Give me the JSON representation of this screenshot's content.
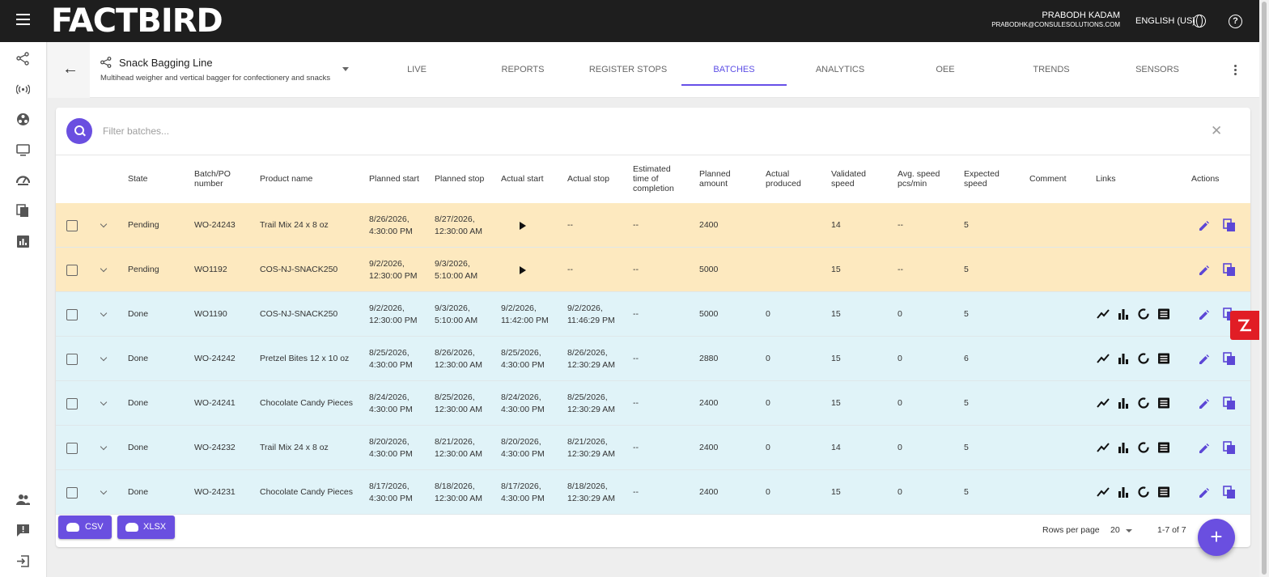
{
  "app": {
    "logo": "FACTBIRD"
  },
  "user": {
    "name": "PRABODH KADAM",
    "email": "PRABODHK@CONSULESOLUTIONS.COM"
  },
  "language": "ENGLISH (US)",
  "line": {
    "name": "Snack Bagging Line",
    "description": "Multihead weigher and vertical bagger for confectionery and snacks"
  },
  "tabs": [
    {
      "label": "LIVE"
    },
    {
      "label": "REPORTS"
    },
    {
      "label": "REGISTER STOPS"
    },
    {
      "label": "BATCHES",
      "active": true
    },
    {
      "label": "ANALYTICS"
    },
    {
      "label": "OEE"
    },
    {
      "label": "TRENDS"
    },
    {
      "label": "SENSORS"
    }
  ],
  "search": {
    "placeholder": "Filter batches..."
  },
  "columns": {
    "state": "State",
    "batch": "Batch/PO number",
    "product": "Product name",
    "planned_start": "Planned start",
    "planned_stop": "Planned stop",
    "actual_start": "Actual start",
    "actual_stop": "Actual stop",
    "est": "Estimated time of completion",
    "planned_amount": "Planned amount",
    "actual_produced": "Actual produced",
    "validated_speed": "Validated speed",
    "avg_speed": "Avg. speed pcs/min",
    "expected_speed": "Expected speed",
    "comment": "Comment",
    "links": "Links",
    "actions": "Actions"
  },
  "rows": [
    {
      "state": "Pending",
      "batch": "WO-24243",
      "product": "Trail Mix 24 x 8 oz",
      "planned_start": [
        "8/26/2026,",
        "4:30:00 PM"
      ],
      "planned_stop": [
        "8/27/2026,",
        "12:30:00 AM"
      ],
      "actual_start": "",
      "actual_stop": "--",
      "est": "--",
      "planned_amount": "2400",
      "actual_produced": "",
      "validated_speed": "14",
      "avg_speed": "--",
      "expected_speed": "5",
      "comment": ""
    },
    {
      "state": "Pending",
      "batch": "WO1192",
      "product": "COS-NJ-SNACK250",
      "planned_start": [
        "9/2/2026,",
        "12:30:00 PM"
      ],
      "planned_stop": [
        "9/3/2026,",
        "5:10:00 AM"
      ],
      "actual_start": "",
      "actual_stop": "--",
      "est": "--",
      "planned_amount": "5000",
      "actual_produced": "",
      "validated_speed": "15",
      "avg_speed": "--",
      "expected_speed": "5",
      "comment": ""
    },
    {
      "state": "Done",
      "batch": "WO1190",
      "product": "COS-NJ-SNACK250",
      "planned_start": [
        "9/2/2026,",
        "12:30:00 PM"
      ],
      "planned_stop": [
        "9/3/2026,",
        "5:10:00 AM"
      ],
      "actual_start": [
        "9/2/2026,",
        "11:42:00 PM"
      ],
      "actual_stop": [
        "9/2/2026,",
        "11:46:29 PM"
      ],
      "est": "--",
      "planned_amount": "5000",
      "actual_produced": "0",
      "validated_speed": "15",
      "avg_speed": "0",
      "expected_speed": "5",
      "comment": ""
    },
    {
      "state": "Done",
      "batch": "WO-24242",
      "product": "Pretzel Bites 12 x 10 oz",
      "planned_start": [
        "8/25/2026,",
        "4:30:00 PM"
      ],
      "planned_stop": [
        "8/26/2026,",
        "12:30:00 AM"
      ],
      "actual_start": [
        "8/25/2026,",
        "4:30:00 PM"
      ],
      "actual_stop": [
        "8/26/2026,",
        "12:30:29 AM"
      ],
      "est": "--",
      "planned_amount": "2880",
      "actual_produced": "0",
      "validated_speed": "15",
      "avg_speed": "0",
      "expected_speed": "6",
      "comment": ""
    },
    {
      "state": "Done",
      "batch": "WO-24241",
      "product": "Chocolate Candy Pieces",
      "planned_start": [
        "8/24/2026,",
        "4:30:00 PM"
      ],
      "planned_stop": [
        "8/25/2026,",
        "12:30:00 AM"
      ],
      "actual_start": [
        "8/24/2026,",
        "4:30:00 PM"
      ],
      "actual_stop": [
        "8/25/2026,",
        "12:30:29 AM"
      ],
      "est": "--",
      "planned_amount": "2400",
      "actual_produced": "0",
      "validated_speed": "15",
      "avg_speed": "0",
      "expected_speed": "5",
      "comment": ""
    },
    {
      "state": "Done",
      "batch": "WO-24232",
      "product": "Trail Mix 24 x 8 oz",
      "planned_start": [
        "8/20/2026,",
        "4:30:00 PM"
      ],
      "planned_stop": [
        "8/21/2026,",
        "12:30:00 AM"
      ],
      "actual_start": [
        "8/20/2026,",
        "4:30:00 PM"
      ],
      "actual_stop": [
        "8/21/2026,",
        "12:30:29 AM"
      ],
      "est": "--",
      "planned_amount": "2400",
      "actual_produced": "0",
      "validated_speed": "14",
      "avg_speed": "0",
      "expected_speed": "5",
      "comment": ""
    },
    {
      "state": "Done",
      "batch": "WO-24231",
      "product": "Chocolate Candy Pieces",
      "planned_start": [
        "8/17/2026,",
        "4:30:00 PM"
      ],
      "planned_stop": [
        "8/18/2026,",
        "12:30:00 AM"
      ],
      "actual_start": [
        "8/17/2026,",
        "4:30:00 PM"
      ],
      "actual_stop": [
        "8/18/2026,",
        "12:30:29 AM"
      ],
      "est": "--",
      "planned_amount": "2400",
      "actual_produced": "0",
      "validated_speed": "15",
      "avg_speed": "0",
      "expected_speed": "5",
      "comment": ""
    }
  ],
  "footer": {
    "csv_label": "CSV",
    "xlsx_label": "XLSX",
    "rows_per_page_label": "Rows per page",
    "rows_per_page": "20",
    "range": "1-7 of 7"
  },
  "colors": {
    "accent": "#6a4fe0",
    "pending_row": "#fde9bf",
    "done_row": "#e0f3f8",
    "topbar": "#1e1e1e"
  }
}
